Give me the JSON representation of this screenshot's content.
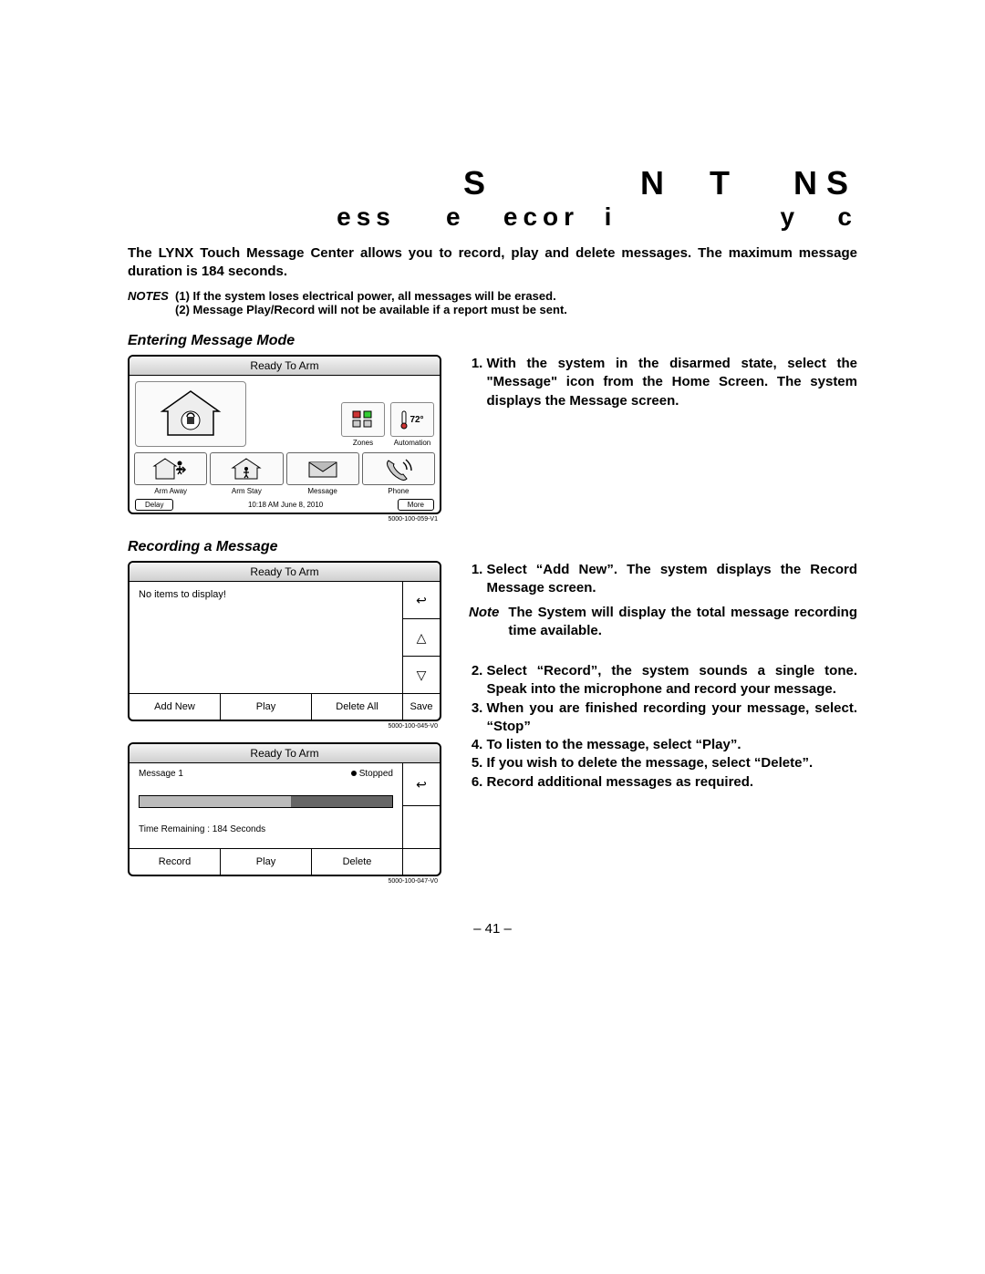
{
  "title_line1": "S        N  T   NS",
  "title_line2": "ess    e   ecor  i             y   c",
  "intro": "The LYNX Touch Message Center allows you to record, play and delete messages. The maximum message duration is 184 seconds.",
  "notes_label": "NOTES",
  "notes_1": "(1)   If the system loses electrical power, all messages will be erased.",
  "notes_2": "(2)   Message Play/Record will not be available if a report must be sent.",
  "sectionA": "Entering Message Mode",
  "sectionB": "Recording a Message",
  "screen_title": "Ready To Arm",
  "screen1": {
    "zones": "Zones",
    "automation": "Automation",
    "temp": "72°",
    "arm_away": "Arm Away",
    "arm_stay": "Arm Stay",
    "message": "Message",
    "phone": "Phone",
    "delay": "Delay",
    "more": "More",
    "timestamp": "10:18 AM June 8, 2010",
    "figid": "5000-100-059-V1"
  },
  "screen2": {
    "empty": "No items to display!",
    "add_new": "Add New",
    "play": "Play",
    "delete_all": "Delete All",
    "save": "Save",
    "figid": "5000-100-045-V0"
  },
  "screen3": {
    "msg": "Message 1",
    "status": "Stopped",
    "time": "Time Remaining   :  184 Seconds",
    "record": "Record",
    "play": "Play",
    "delete": "Delete",
    "figid": "5000-100-047-V0"
  },
  "stepA1": "With the system in the disarmed state, select the \"Message\" icon from the Home Screen. The system displays the Message screen.",
  "stepB1": "Select “Add New”. The system displays the Record Message screen.",
  "stepB_note_label": "Note",
  "stepB_note": "The System will display the total message recording time available.",
  "stepB2": "Select “Record”, the system sounds a single tone. Speak into the microphone and record your message.",
  "stepB3": "When you are finished recording your message, select. “Stop”",
  "stepB4": "To listen to the message, select “Play”.",
  "stepB5": "If you wish to delete the message, select “Delete”.",
  "stepB6": "Record additional messages as required.",
  "page_number": "– 41 –"
}
